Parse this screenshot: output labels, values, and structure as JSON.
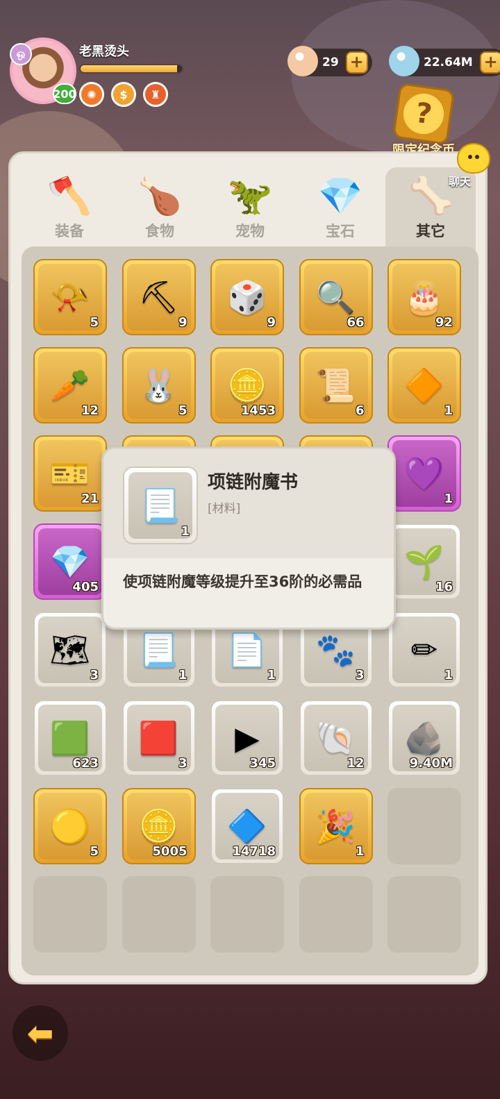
{
  "player": {
    "name": "老黑烫头",
    "level": "200",
    "tag": "ஒ",
    "exp_fraction": 0.95
  },
  "buffs": [
    {
      "icon": "gear-buff-icon",
      "glyph": "✺",
      "color": "#f07a2a"
    },
    {
      "icon": "coin-buff-icon",
      "glyph": "$",
      "color": "#f2a230"
    },
    {
      "icon": "shield-buff-icon",
      "glyph": "♜",
      "color": "#e8612a"
    }
  ],
  "currencies": [
    {
      "name": "shell",
      "value": "29",
      "color": "#f4c9a4"
    },
    {
      "name": "diamond",
      "value": "22.64M",
      "color": "#9fd4ea"
    }
  ],
  "plus_label": "+",
  "limited_coin": {
    "label": "限定纪念币",
    "glyph": "?"
  },
  "chat": {
    "label": "聊天"
  },
  "tabs": [
    {
      "label": "装备",
      "icon": "axe-icon",
      "glyph": "🪓"
    },
    {
      "label": "食物",
      "icon": "food-bowl-icon",
      "glyph": "🍗"
    },
    {
      "label": "宠物",
      "icon": "dragon-skull-icon",
      "glyph": "🦖"
    },
    {
      "label": "宝石",
      "icon": "gem-icon",
      "glyph": "💎"
    },
    {
      "label": "其它",
      "icon": "bone-icon",
      "glyph": "🦴"
    }
  ],
  "active_tab": 4,
  "items": [
    {
      "qty": "5",
      "rarity": "gold",
      "icon": "horn-icon",
      "glyph": "📯"
    },
    {
      "qty": "9",
      "rarity": "gold",
      "icon": "pickaxe-icon",
      "glyph": "⛏"
    },
    {
      "qty": "9",
      "rarity": "gold",
      "icon": "dice-icon",
      "glyph": "🎲"
    },
    {
      "qty": "66",
      "rarity": "gold",
      "icon": "magnifier-icon",
      "glyph": "🔍"
    },
    {
      "qty": "92",
      "rarity": "gold",
      "icon": "cake-coin-icon",
      "glyph": "🎂"
    },
    {
      "qty": "12",
      "rarity": "gold",
      "icon": "carrot-bag-icon",
      "glyph": "🥕"
    },
    {
      "qty": "5",
      "rarity": "gold",
      "icon": "pet-bag-icon",
      "glyph": "🐰"
    },
    {
      "qty": "1453",
      "rarity": "gold",
      "icon": "spiral-coin-icon",
      "glyph": "🪙"
    },
    {
      "qty": "6",
      "rarity": "gold",
      "icon": "scroll-icon",
      "glyph": "📜"
    },
    {
      "qty": "1",
      "rarity": "gold",
      "icon": "amber-icon",
      "glyph": "🔶"
    },
    {
      "qty": "21",
      "rarity": "gold",
      "icon": "blue-ticket-icon",
      "glyph": "🎫"
    },
    {
      "qty": "",
      "rarity": "gold",
      "icon": "hidden-item-icon",
      "glyph": ""
    },
    {
      "qty": "",
      "rarity": "gold",
      "icon": "hidden-item-icon",
      "glyph": ""
    },
    {
      "qty": "",
      "rarity": "gold",
      "icon": "hidden-item-icon",
      "glyph": ""
    },
    {
      "qty": "1",
      "rarity": "purple",
      "icon": "purple-crystal-icon",
      "glyph": "💜"
    },
    {
      "qty": "405",
      "rarity": "purple",
      "icon": "pink-crystal-icon",
      "glyph": "💎"
    },
    {
      "qty": "",
      "rarity": "white",
      "icon": "hidden-item-icon",
      "glyph": ""
    },
    {
      "qty": "",
      "rarity": "white",
      "icon": "hidden-item-icon",
      "glyph": ""
    },
    {
      "qty": "",
      "rarity": "white",
      "icon": "hidden-item-icon",
      "glyph": ""
    },
    {
      "qty": "16",
      "rarity": "white",
      "icon": "seed-bag-icon",
      "glyph": "🌱"
    },
    {
      "qty": "3",
      "rarity": "white",
      "icon": "orange-scroll-icon",
      "glyph": "🗺"
    },
    {
      "qty": "1",
      "rarity": "white",
      "icon": "necklace-book-icon",
      "glyph": "📃"
    },
    {
      "qty": "1",
      "rarity": "white",
      "icon": "purple-book-icon",
      "glyph": "📄"
    },
    {
      "qty": "3",
      "rarity": "white",
      "icon": "paw-ticket-icon",
      "glyph": "🐾"
    },
    {
      "qty": "1",
      "rarity": "white",
      "icon": "blue-card-icon",
      "glyph": "✏"
    },
    {
      "qty": "623",
      "rarity": "white",
      "icon": "green-ticket-icon",
      "glyph": "🟩"
    },
    {
      "qty": "3",
      "rarity": "white",
      "icon": "red-ticket-icon",
      "glyph": "🟥"
    },
    {
      "qty": "345",
      "rarity": "white",
      "icon": "brown-ticket-icon",
      "glyph": "▶"
    },
    {
      "qty": "12",
      "rarity": "white",
      "icon": "shell-coin-icon",
      "glyph": "🐚"
    },
    {
      "qty": "9.40M",
      "rarity": "white",
      "icon": "stone-icon",
      "glyph": "🪨"
    },
    {
      "qty": "5",
      "rarity": "gold",
      "icon": "fire-orb-icon",
      "glyph": "🟡"
    },
    {
      "qty": "5005",
      "rarity": "gold",
      "icon": "gold-coin-icon",
      "glyph": "🪙"
    },
    {
      "qty": "14718",
      "rarity": "white",
      "icon": "rainbow-crystal-icon",
      "glyph": "🔷"
    },
    {
      "qty": "1",
      "rarity": "gold",
      "icon": "anniversary-icon",
      "glyph": "🎉"
    },
    {
      "qty": "",
      "rarity": "empty",
      "icon": "",
      "glyph": ""
    },
    {
      "qty": "",
      "rarity": "empty",
      "icon": "",
      "glyph": ""
    },
    {
      "qty": "",
      "rarity": "empty",
      "icon": "",
      "glyph": ""
    },
    {
      "qty": "",
      "rarity": "empty",
      "icon": "",
      "glyph": ""
    },
    {
      "qty": "",
      "rarity": "empty",
      "icon": "",
      "glyph": ""
    },
    {
      "qty": "",
      "rarity": "empty",
      "icon": "",
      "glyph": ""
    }
  ],
  "tooltip": {
    "title": "项链附魔书",
    "type": "[材料]",
    "qty": "1",
    "icon": "necklace-book-icon",
    "glyph": "📃",
    "description": "使项链附魔等级提升至36阶的必需品"
  },
  "back": {
    "glyph": "⬅"
  }
}
